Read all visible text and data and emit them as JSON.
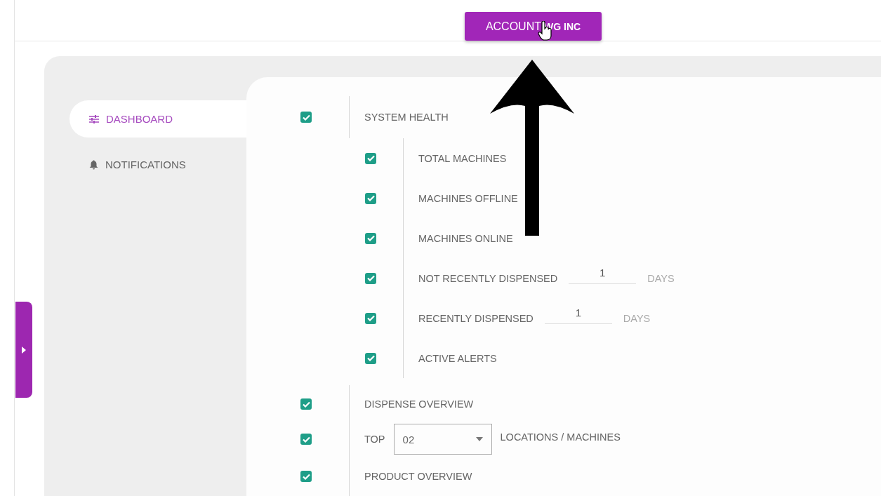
{
  "account_button": {
    "label": "ACCOUNT",
    "value": "WG INC"
  },
  "sidebar": {
    "items": [
      {
        "label": "DASHBOARD",
        "kind": "sliders",
        "selected": true
      },
      {
        "label": "NOTIFICATIONS",
        "kind": "bell",
        "selected": false
      }
    ]
  },
  "sections": [
    {
      "label": "SYSTEM HEALTH",
      "checked": true,
      "children": [
        {
          "kind": "plain",
          "label": "TOTAL MACHINES",
          "checked": true
        },
        {
          "kind": "plain",
          "label": "MACHINES OFFLINE",
          "checked": true
        },
        {
          "kind": "plain",
          "label": "MACHINES ONLINE",
          "checked": true
        },
        {
          "kind": "days",
          "label": "NOT RECENTLY DISPENSED",
          "checked": true,
          "value": "1",
          "unit": "DAYS"
        },
        {
          "kind": "days",
          "label": "RECENTLY DISPENSED",
          "checked": true,
          "value": "1",
          "unit": "DAYS"
        },
        {
          "kind": "plain",
          "label": "ACTIVE ALERTS",
          "checked": true
        }
      ]
    },
    {
      "label": "DISPENSE OVERVIEW",
      "checked": true
    },
    {
      "kind": "select",
      "label": "TOP",
      "checked": true,
      "value": "02",
      "suffix": "LOCATIONS / MACHINES"
    },
    {
      "label": "PRODUCT OVERVIEW",
      "checked": true
    }
  ]
}
